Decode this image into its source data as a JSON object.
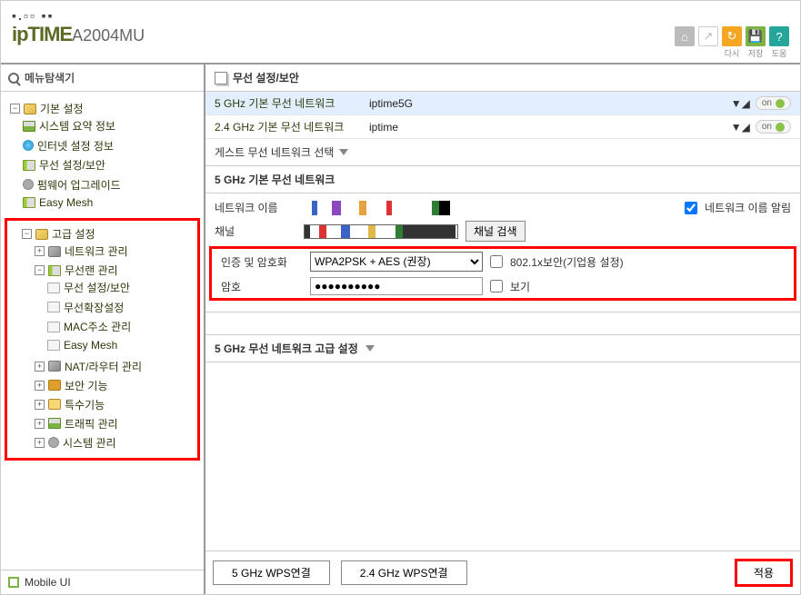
{
  "header": {
    "dots": "▪.▫▫ ▪▪",
    "brand": "ipTIME",
    "model": "A2004MU",
    "icons": {
      "home_label": "",
      "export_label": "",
      "reload_label": "다시",
      "save_label": "저장",
      "help_label": "도움"
    }
  },
  "sidebar": {
    "title": "메뉴탐색기",
    "mobile": "Mobile UI",
    "basic": {
      "label": "기본 설정",
      "items": [
        "시스템 요약 정보",
        "인터넷 설정 정보",
        "무선 설정/보안",
        "펌웨어 업그레이드",
        "Easy Mesh"
      ]
    },
    "advanced": {
      "label": "고급 설정",
      "network": "네트워크 관리",
      "wireless": {
        "label": "무선랜 관리",
        "items": [
          "무선 설정/보안",
          "무선확장설정",
          "MAC주소 관리",
          "Easy Mesh"
        ]
      },
      "nat": "NAT/라우터 관리",
      "security": "보안 기능",
      "special": "특수기능",
      "traffic": "트래픽 관리",
      "system": "시스템 관리"
    }
  },
  "main": {
    "title": "무선 설정/보안",
    "net5_label": "5 GHz 기본 무선 네트워크",
    "net5_ssid": "iptime5G",
    "net24_label": "2.4 GHz 기본 무선 네트워크",
    "net24_ssid": "iptime",
    "on": "on",
    "guest_label": "게스트 무선 네트워크 선택",
    "section_5g": "5 GHz 기본 무선 네트워크",
    "form": {
      "name_label": "네트워크 이름",
      "name_broadcast": "네트워크 이름 알림",
      "channel_label": "채널",
      "channel_search_btn": "채널 검색",
      "auth_label": "인증 및 암호화",
      "auth_value": "WPA2PSK + AES (권장)",
      "dot1x": "802.1x보안(기업용 설정)",
      "pw_label": "암호",
      "pw_value": "●●●●●●●●●●",
      "pw_show": "보기"
    },
    "adv_title": "5 GHz 무선 네트워크 고급 설정",
    "footer": {
      "wps5": "5 GHz WPS연결",
      "wps24": "2.4 GHz WPS연결",
      "apply": "적용"
    }
  }
}
